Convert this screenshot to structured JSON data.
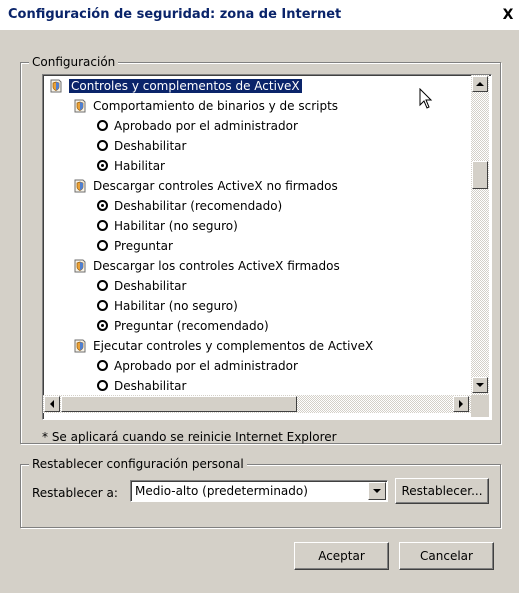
{
  "window": {
    "title": "Configuración de seguridad: zona de Internet",
    "close_glyph": "X"
  },
  "settings_group": {
    "legend": "Configuración",
    "items": [
      {
        "level": "cat",
        "type": "category",
        "label": "Controles y complementos de ActiveX",
        "selected": true
      },
      {
        "level": "sub",
        "type": "category",
        "label": "Comportamiento de binarios y de scripts"
      },
      {
        "level": "opt",
        "type": "option",
        "label": "Aprobado por el administrador",
        "checked": false
      },
      {
        "level": "opt",
        "type": "option",
        "label": "Deshabilitar",
        "checked": false
      },
      {
        "level": "opt",
        "type": "option",
        "label": "Habilitar",
        "checked": true
      },
      {
        "level": "sub",
        "type": "category",
        "label": "Descargar controles ActiveX no firmados"
      },
      {
        "level": "opt",
        "type": "option",
        "label": "Deshabilitar (recomendado)",
        "checked": true
      },
      {
        "level": "opt",
        "type": "option",
        "label": "Habilitar (no seguro)",
        "checked": false
      },
      {
        "level": "opt",
        "type": "option",
        "label": "Preguntar",
        "checked": false
      },
      {
        "level": "sub",
        "type": "category",
        "label": "Descargar los controles ActiveX firmados"
      },
      {
        "level": "opt",
        "type": "option",
        "label": "Deshabilitar",
        "checked": false
      },
      {
        "level": "opt",
        "type": "option",
        "label": "Habilitar (no seguro)",
        "checked": false
      },
      {
        "level": "opt",
        "type": "option",
        "label": "Preguntar (recomendado)",
        "checked": true
      },
      {
        "level": "sub",
        "type": "category",
        "label": "Ejecutar controles y complementos de ActiveX"
      },
      {
        "level": "opt",
        "type": "option",
        "label": "Aprobado por el administrador",
        "checked": false
      },
      {
        "level": "opt",
        "type": "option",
        "label": "Deshabilitar",
        "checked": false
      }
    ],
    "note": "* Se aplicará cuando se reinicie Internet Explorer"
  },
  "reset_group": {
    "legend": "Restablecer configuración personal",
    "label": "Restablecer a:",
    "selected_value": "Medio-alto (predeterminado)",
    "reset_button": "Restablecer..."
  },
  "buttons": {
    "ok": "Aceptar",
    "cancel": "Cancelar"
  },
  "colors": {
    "dialog_bg": "#d4d0c8",
    "selection": "#0a246a",
    "title_text": "#0a246a"
  }
}
